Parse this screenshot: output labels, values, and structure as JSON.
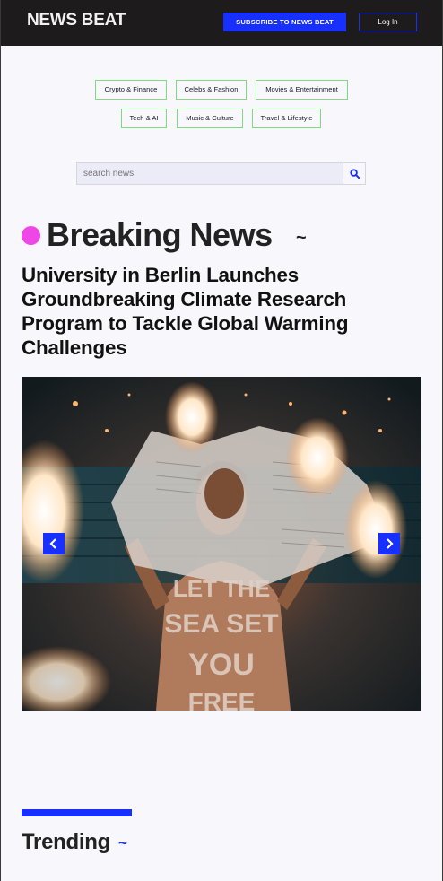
{
  "header": {
    "logo": "NEWS BEAT",
    "subscribe_label": "SUBSCRIBE TO NEWS BEAT",
    "login_label": "Log In"
  },
  "categories": [
    "Crypto & Finance",
    "Celebs & Fashion",
    "Movies & Entertainment",
    "Tech & AI",
    "Music & Culture",
    "Travel & Lifestyle"
  ],
  "search": {
    "placeholder": "search news",
    "value": "",
    "icon": "search-icon"
  },
  "breaking": {
    "title": "Breaking News",
    "tilde": "~",
    "headline": "University in Berlin Launches Groundbreaking Climate Research Program to Tackle Global Warming Challenges"
  },
  "carousel": {
    "image_text_lines": [
      "LET THE",
      "SEA SET",
      "YOU",
      "FREE"
    ],
    "prev_icon": "chevron-left-icon",
    "next_icon": "chevron-right-icon"
  },
  "trending": {
    "title": "Trending",
    "tilde": "~"
  },
  "colors": {
    "accent_blue": "#1730ff",
    "accent_pink": "#ef47e6",
    "category_border": "#7ddc7d",
    "header_bg": "#1d1b1b"
  }
}
